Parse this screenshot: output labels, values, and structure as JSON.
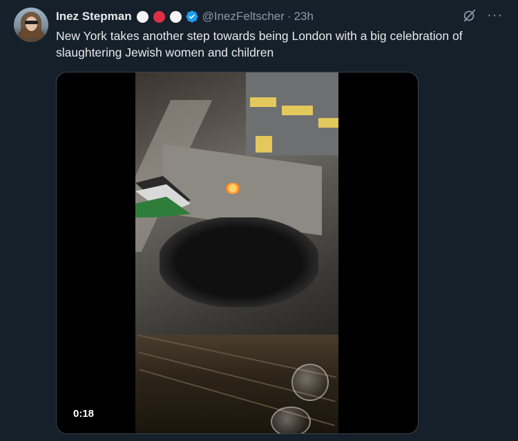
{
  "author": {
    "display_name": "Inez Stepman",
    "handle": "@InezFeltscher",
    "separator": "·",
    "time": "23h",
    "badge_dots": [
      {
        "name": "white-circle-emoji-1",
        "color": "#f5f5f5"
      },
      {
        "name": "red-circle-emoji",
        "color": "#dd2e44"
      },
      {
        "name": "white-circle-emoji-2",
        "color": "#f5f5f5"
      }
    ],
    "verified_icon": "verified-badge-icon",
    "verified_color": "#1d9bf0"
  },
  "tweet": {
    "text": "New York takes another step towards being London with a big celebration of slaughtering Jewish women and children"
  },
  "media": {
    "type": "video",
    "duration": "0:18"
  },
  "icons": {
    "grok": "grok-icon",
    "more": "more-options-icon"
  },
  "colors": {
    "background": "#15202b",
    "text_primary": "#e7e9ea",
    "text_secondary": "#8b98a5",
    "border": "#38444d"
  }
}
